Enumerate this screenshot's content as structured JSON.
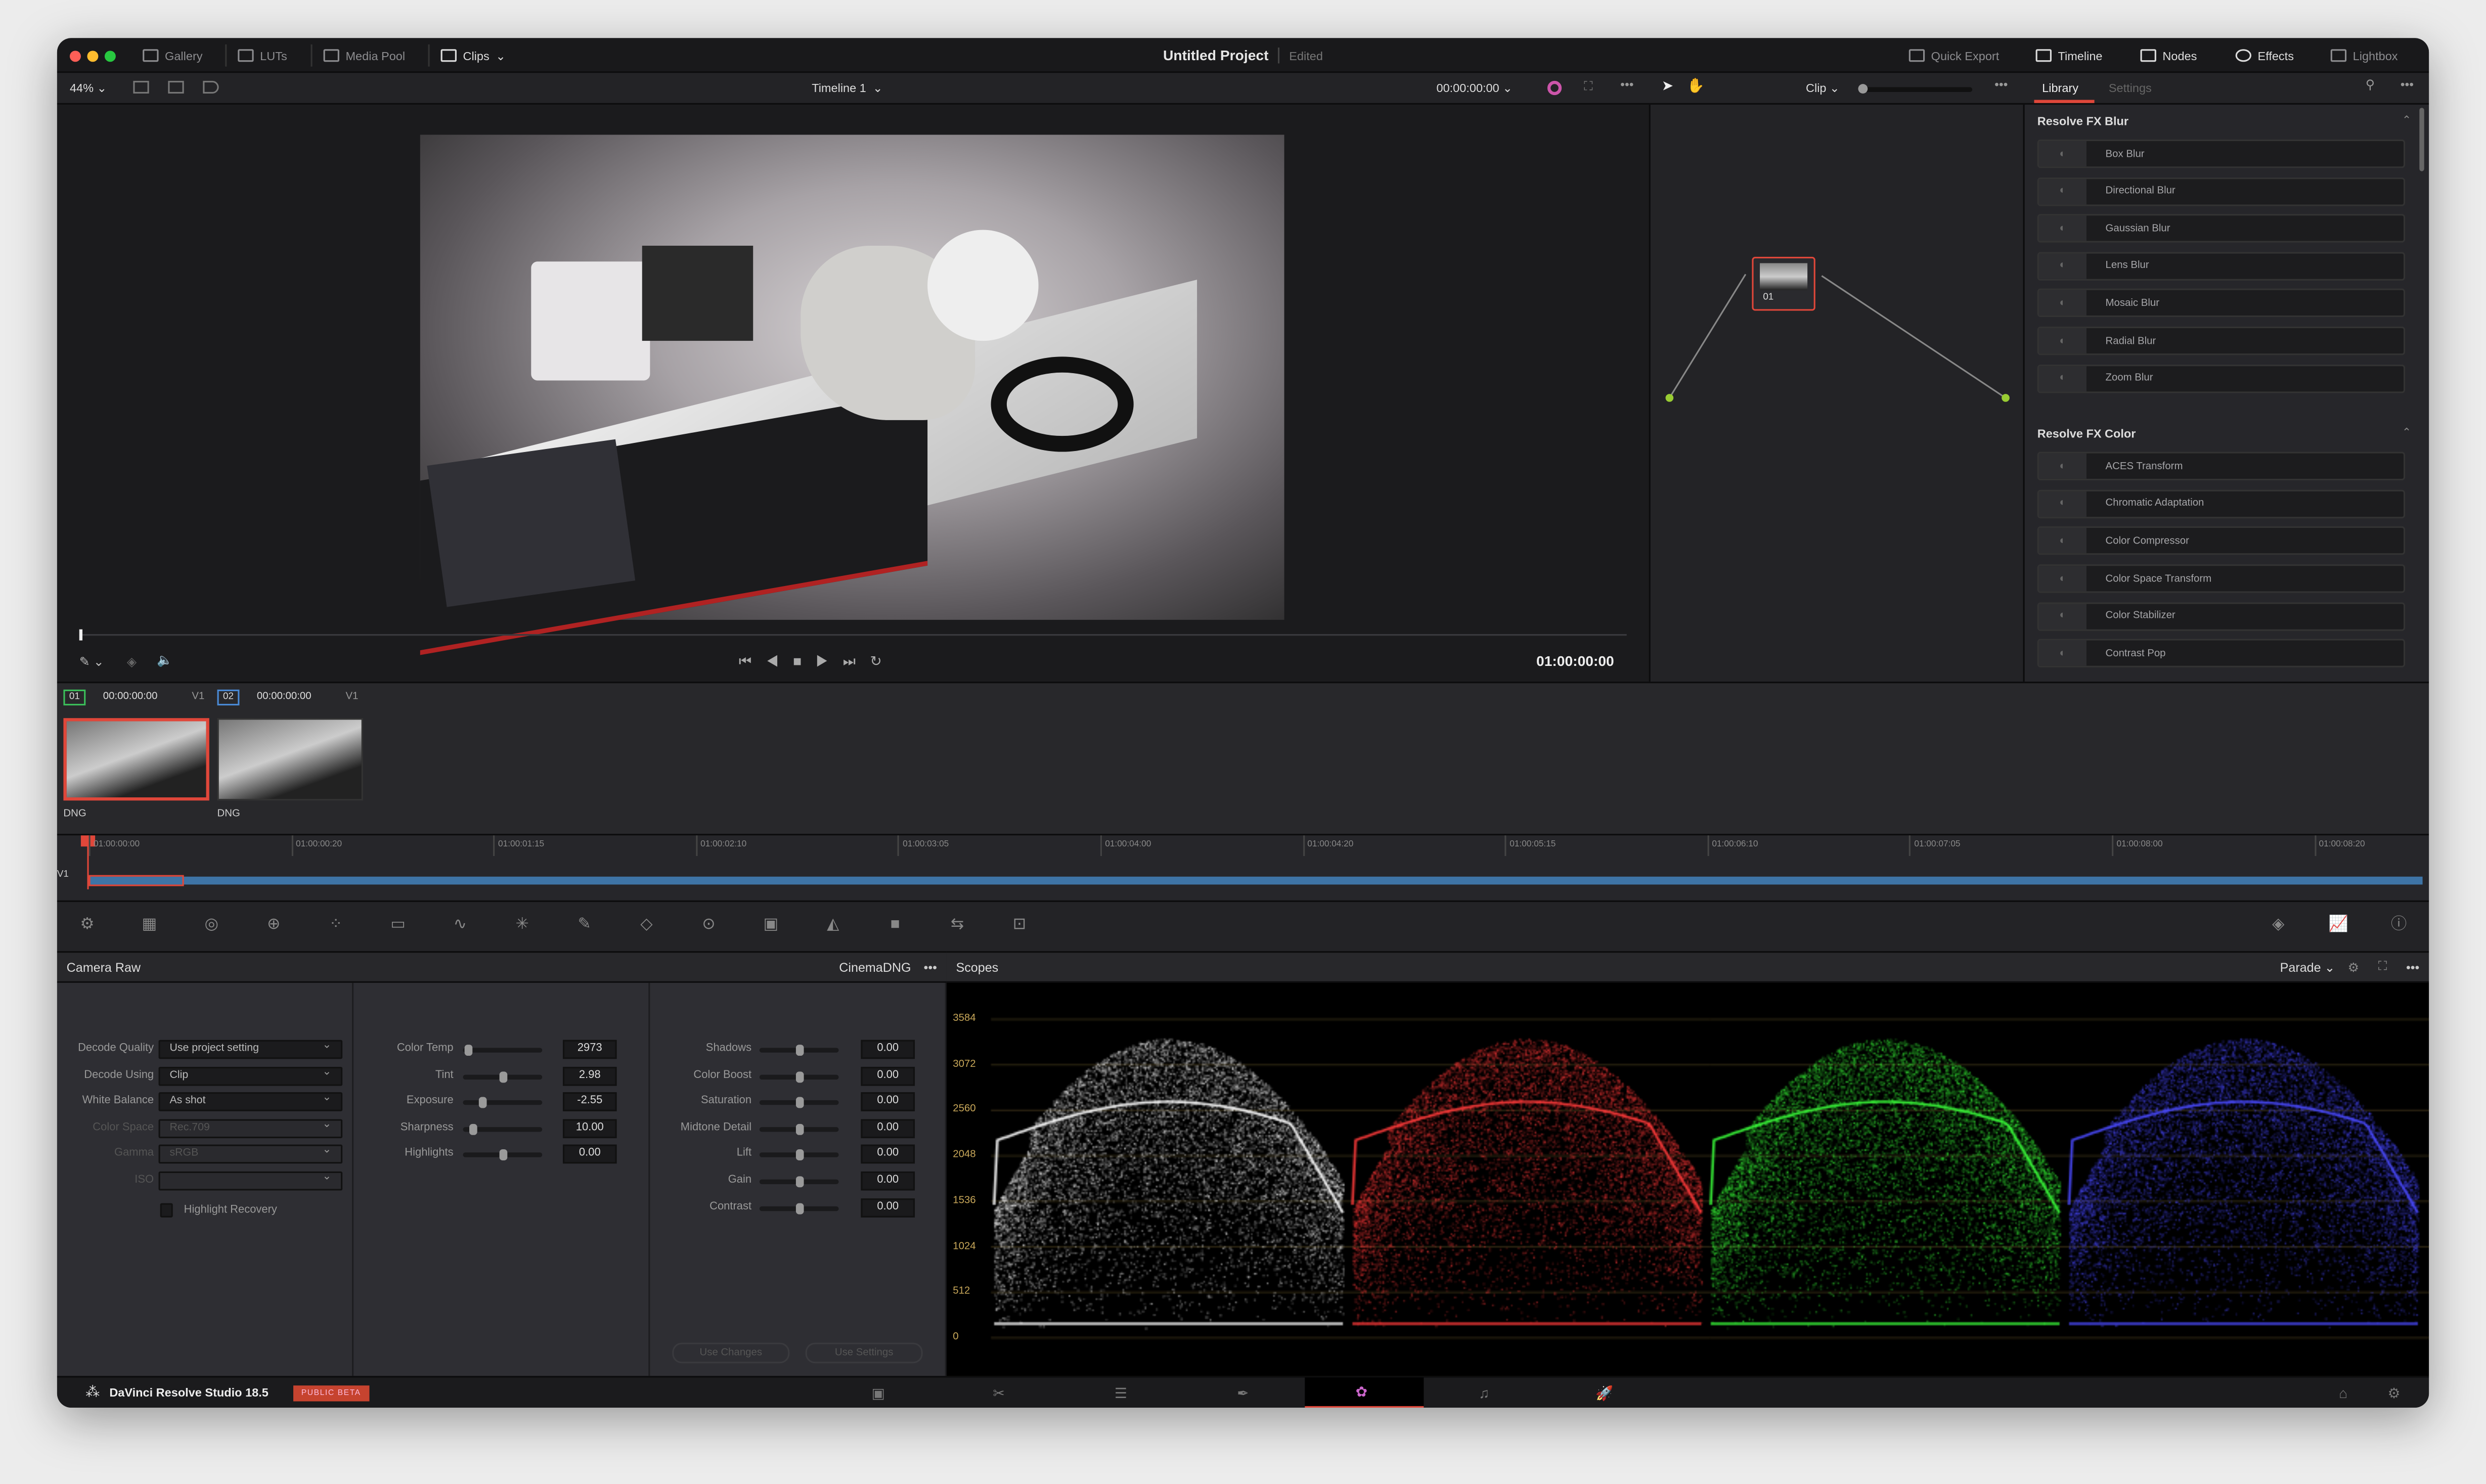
{
  "titlebar": {
    "tabs_left": [
      {
        "label": "Gallery",
        "icon": "gallery-icon"
      },
      {
        "label": "LUTs",
        "icon": "luts-icon"
      },
      {
        "label": "Media Pool",
        "icon": "media-pool-icon"
      },
      {
        "label": "Clips",
        "icon": "clips-icon"
      }
    ],
    "project_title": "Untitled Project",
    "status": "Edited",
    "tabs_right": [
      {
        "label": "Quick Export",
        "icon": "export-icon"
      },
      {
        "label": "Timeline",
        "icon": "timeline-icon"
      },
      {
        "label": "Nodes",
        "icon": "nodes-icon"
      },
      {
        "label": "Effects",
        "icon": "fx-icon"
      },
      {
        "label": "Lightbox",
        "icon": "lightbox-icon"
      }
    ]
  },
  "viewer": {
    "zoom": "44%",
    "timeline_name": "Timeline 1",
    "timecode": "00:00:00:00",
    "transport_timecode": "01:00:00:00"
  },
  "nodes": {
    "mode": "Clip",
    "node_label": "01"
  },
  "library": {
    "tabs": [
      "Library",
      "Settings"
    ],
    "sections": [
      {
        "title": "Resolve FX Blur",
        "items": [
          "Box Blur",
          "Directional Blur",
          "Gaussian Blur",
          "Lens Blur",
          "Mosaic Blur",
          "Radial Blur",
          "Zoom Blur"
        ]
      },
      {
        "title": "Resolve FX Color",
        "items": [
          "ACES Transform",
          "Chromatic Adaptation",
          "Color Compressor",
          "Color Space Transform",
          "Color Stabilizer",
          "Contrast Pop"
        ]
      }
    ]
  },
  "clips": [
    {
      "num": "01",
      "tc": "00:00:00:00",
      "track": "V1",
      "format": "DNG"
    },
    {
      "num": "02",
      "tc": "00:00:00:00",
      "track": "V1",
      "format": "DNG"
    }
  ],
  "timeline": {
    "track": "V1",
    "ruler": [
      "01:00:00:00",
      "01:00:00:20",
      "01:00:01:15",
      "01:00:02:10",
      "01:00:03:05",
      "01:00:04:00",
      "01:00:04:20",
      "01:00:05:15",
      "01:00:06:10",
      "01:00:07:05",
      "01:00:08:00",
      "01:00:08:20"
    ]
  },
  "camera_raw": {
    "title": "Camera Raw",
    "format": "CinemaDNG",
    "decode": [
      {
        "label": "Decode Quality",
        "value": "Use project setting",
        "disabled": false
      },
      {
        "label": "Decode Using",
        "value": "Clip",
        "disabled": false
      },
      {
        "label": "White Balance",
        "value": "As shot",
        "disabled": false
      },
      {
        "label": "Color Space",
        "value": "Rec.709",
        "disabled": true
      },
      {
        "label": "Gamma",
        "value": "sRGB",
        "disabled": true
      },
      {
        "label": "ISO",
        "value": "",
        "disabled": true
      }
    ],
    "highlight_recovery": "Highlight Recovery",
    "highlight_recovery_checked": false,
    "sliders1": [
      {
        "label": "Color Temp",
        "value": "2973",
        "pos": 0.02
      },
      {
        "label": "Tint",
        "value": "2.98",
        "pos": 0.5
      },
      {
        "label": "Exposure",
        "value": "-2.55",
        "pos": 0.22
      },
      {
        "label": "Sharpness",
        "value": "10.00",
        "pos": 0.08
      },
      {
        "label": "Highlights",
        "value": "0.00",
        "pos": 0.5
      }
    ],
    "sliders2": [
      {
        "label": "Shadows",
        "value": "0.00",
        "pos": 0.5
      },
      {
        "label": "Color Boost",
        "value": "0.00",
        "pos": 0.5
      },
      {
        "label": "Saturation",
        "value": "0.00",
        "pos": 0.5
      },
      {
        "label": "Midtone Detail",
        "value": "0.00",
        "pos": 0.5
      },
      {
        "label": "Lift",
        "value": "0.00",
        "pos": 0.5
      },
      {
        "label": "Gain",
        "value": "0.00",
        "pos": 0.5
      },
      {
        "label": "Contrast",
        "value": "0.00",
        "pos": 0.5
      }
    ],
    "use_changes": "Use Changes",
    "use_settings": "Use Settings"
  },
  "scopes": {
    "title": "Scopes",
    "mode": "Parade",
    "scale": [
      "3584",
      "3072",
      "2560",
      "2048",
      "1536",
      "1024",
      "512",
      "0"
    ],
    "colors": [
      "#ffffff",
      "#ff3b3b",
      "#3bff3b",
      "#4a4aff"
    ]
  },
  "footer": {
    "app": "DaVinci Resolve Studio 18.5",
    "badge": "PUBLIC BETA",
    "accent": "#e0473a"
  }
}
